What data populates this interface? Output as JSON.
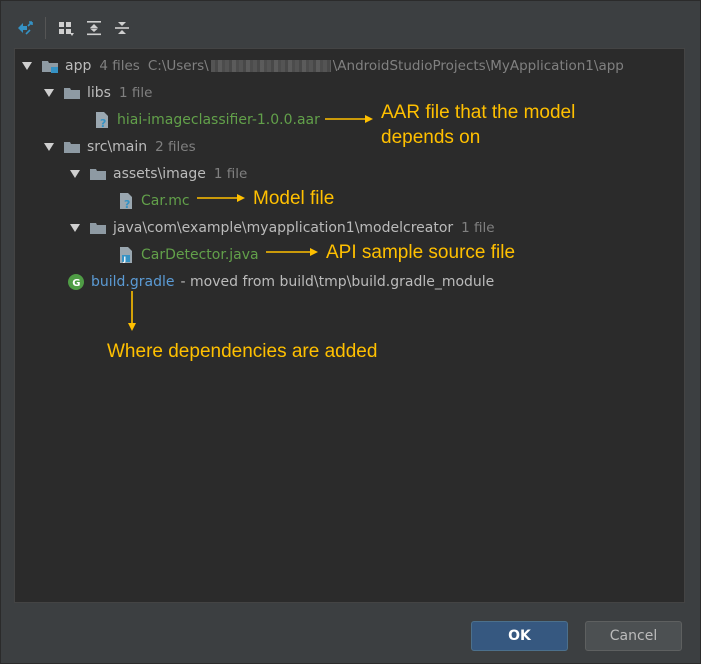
{
  "toolbar": {
    "icons": [
      "collapse-expand-icon",
      "group-by-icon",
      "expand-all-icon",
      "collapse-all-icon"
    ]
  },
  "tree": {
    "root": {
      "name": "app",
      "meta": "4 files",
      "path_prefix": "C:\\Users\\",
      "path_suffix": "\\AndroidStudioProjects\\MyApplication1\\app"
    },
    "libs": {
      "name": "libs",
      "meta": "1 file"
    },
    "aar": {
      "name": "hiai-imageclassifier-1.0.0.aar"
    },
    "srcmain": {
      "name": "src\\main",
      "meta": "2 files"
    },
    "assets": {
      "name": "assets\\image",
      "meta": "1 file"
    },
    "carmc": {
      "name": "Car.mc"
    },
    "java": {
      "name": "java\\com\\example\\myapplication1\\modelcreator",
      "meta": "1 file"
    },
    "cardetector": {
      "name": "CarDetector.java"
    },
    "gradle": {
      "name": "build.gradle",
      "moved": "- moved from build\\tmp\\build.gradle_module"
    }
  },
  "annotations": {
    "aar_line1": "AAR file that the model",
    "aar_line2": "depends on",
    "model": "Model file",
    "api": "API sample source file",
    "dependencies": "Where dependencies are added"
  },
  "buttons": {
    "ok": "OK",
    "cancel": "Cancel"
  },
  "colors": {
    "accent": "#3592c4",
    "annotation": "#ffc000",
    "green_file": "#62a04a",
    "blue_file": "#5b9bd5",
    "ok_button": "#365880"
  }
}
